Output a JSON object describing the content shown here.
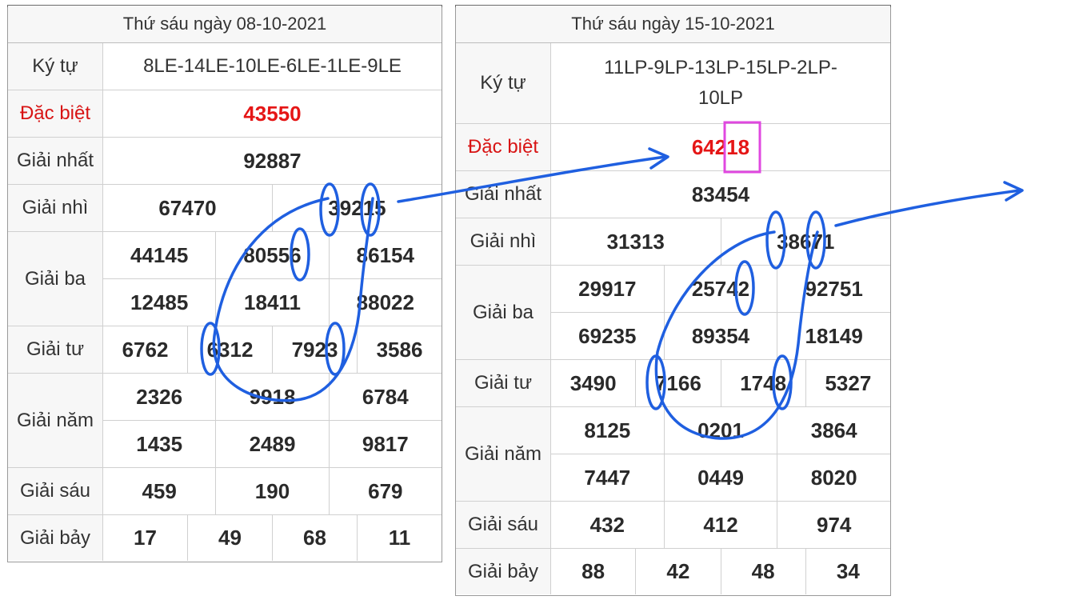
{
  "tables": [
    {
      "date_title": "Thứ sáu ngày 08-10-2021",
      "rows": [
        {
          "label": "Ký tự",
          "values": [
            "8LE-14LE-10LE-6LE-1LE-9LE"
          ]
        },
        {
          "label": "Đặc biệt",
          "values": [
            "43550"
          ]
        },
        {
          "label": "Giải nhất",
          "values": [
            "92887"
          ]
        },
        {
          "label": "Giải nhì",
          "values": [
            "67470",
            "39215"
          ]
        },
        {
          "label": "Giải ba",
          "values": [
            "44145",
            "80556",
            "86154",
            "12485",
            "18411",
            "88022"
          ]
        },
        {
          "label": "Giải tư",
          "values": [
            "6762",
            "6312",
            "7923",
            "3586"
          ]
        },
        {
          "label": "Giải năm",
          "values": [
            "2326",
            "9918",
            "6784",
            "1435",
            "2489",
            "9817"
          ]
        },
        {
          "label": "Giải sáu",
          "values": [
            "459",
            "190",
            "679"
          ]
        },
        {
          "label": "Giải bảy",
          "values": [
            "17",
            "49",
            "68",
            "11"
          ]
        }
      ]
    },
    {
      "date_title": "Thứ sáu ngày 15-10-2021",
      "rows": [
        {
          "label": "Ký tự",
          "values": [
            "11LP-9LP-13LP-15LP-2LP-",
            "10LP"
          ]
        },
        {
          "label": "Đặc biệt",
          "values": [
            "64218"
          ]
        },
        {
          "label": "Giải nhất",
          "values": [
            "83454"
          ]
        },
        {
          "label": "Giải nhì",
          "values": [
            "31313",
            "38671"
          ]
        },
        {
          "label": "Giải ba",
          "values": [
            "29917",
            "25742",
            "92751",
            "69235",
            "89354",
            "18149"
          ]
        },
        {
          "label": "Giải tư",
          "values": [
            "3490",
            "7166",
            "1748",
            "5327"
          ]
        },
        {
          "label": "Giải năm",
          "values": [
            "8125",
            "0201",
            "3864",
            "7447",
            "0449",
            "8020"
          ]
        },
        {
          "label": "Giải sáu",
          "values": [
            "432",
            "412",
            "974"
          ]
        },
        {
          "label": "Giải bảy",
          "values": [
            "88",
            "42",
            "48",
            "34"
          ]
        }
      ]
    }
  ],
  "colors": {
    "special_prize": "#e51616",
    "annotation_blue": "#1f5fe0",
    "highlight_box": "#e048e0"
  }
}
